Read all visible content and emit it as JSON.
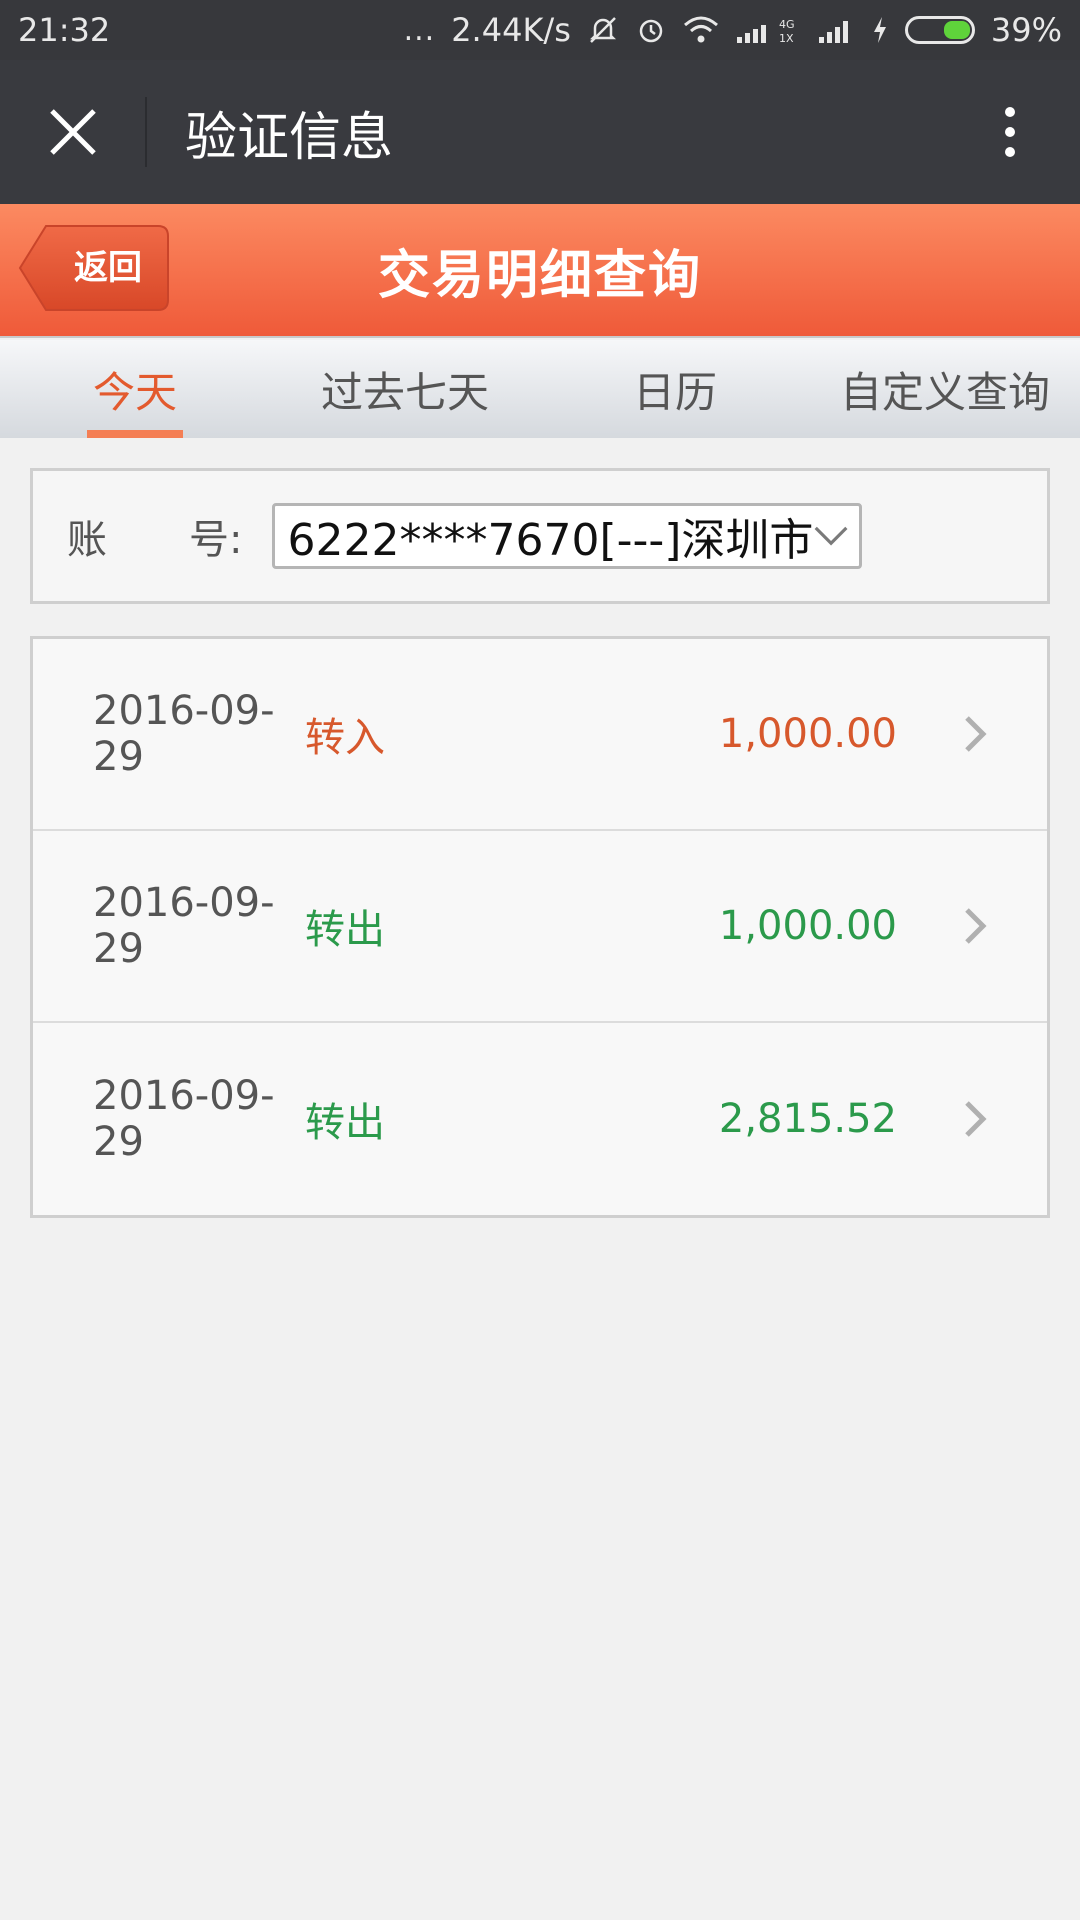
{
  "status_bar": {
    "time": "21:32",
    "dots": "...",
    "speed": "2.44K/s",
    "network_label": "4G\n1X",
    "battery": "39%"
  },
  "app_bar": {
    "title": "验证信息"
  },
  "header": {
    "back_label": "返回",
    "title": "交易明细查询"
  },
  "tabs": [
    {
      "label": "今天",
      "active": true
    },
    {
      "label": "过去七天",
      "active": false
    },
    {
      "label": "日历",
      "active": false
    },
    {
      "label": "自定义查询",
      "active": false
    }
  ],
  "account": {
    "label_a": "账",
    "label_b": "号:",
    "selected": "6222****7670[---]深圳市"
  },
  "transactions": [
    {
      "date": "2016-09-29",
      "type": "转入",
      "amount": "1,000.00",
      "direction": "in"
    },
    {
      "date": "2016-09-29",
      "type": "转出",
      "amount": "1,000.00",
      "direction": "out"
    },
    {
      "date": "2016-09-29",
      "type": "转出",
      "amount": "2,815.52",
      "direction": "out"
    }
  ],
  "colors": {
    "header_orange": "#ef5a39",
    "incoming": "#d7582c",
    "outgoing": "#2b9a4b",
    "tab_active": "#e35a2e"
  }
}
